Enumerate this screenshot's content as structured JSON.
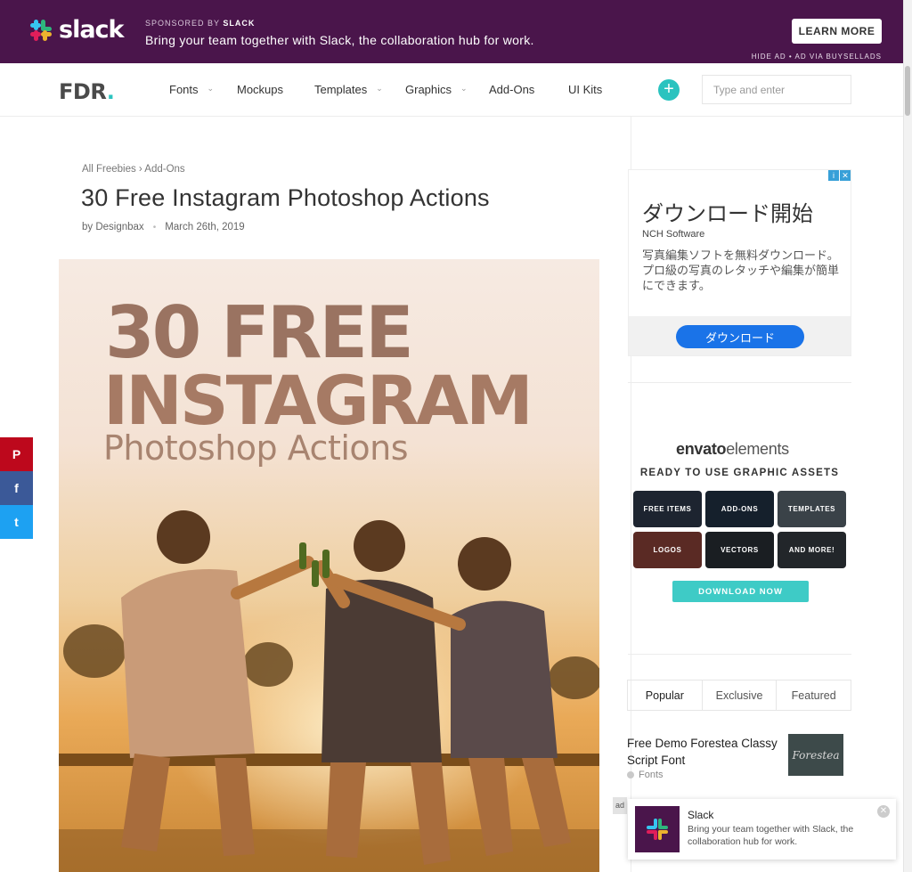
{
  "banner": {
    "sponsored_prefix": "SPONSORED BY",
    "sponsored_brand": "SLACK",
    "logo_text": "slack",
    "text": "Bring your team together with Slack, the collaboration hub for work.",
    "cta": "LEARN MORE",
    "hide_ad": "HIDE AD • AD VIA BUYSELLADS",
    "bg_color": "#4a154b"
  },
  "nav": {
    "logo": "FDR",
    "logo_dot": ".",
    "items": [
      {
        "label": "Fonts",
        "has_dropdown": true
      },
      {
        "label": "Mockups",
        "has_dropdown": false
      },
      {
        "label": "Templates",
        "has_dropdown": true
      },
      {
        "label": "Graphics",
        "has_dropdown": true
      },
      {
        "label": "Add-Ons",
        "has_dropdown": false
      },
      {
        "label": "UI Kits",
        "has_dropdown": false
      }
    ],
    "add_icon": "plus-circle-icon",
    "search_placeholder": "Type and enter",
    "accent_color": "#2bc4c0"
  },
  "article": {
    "breadcrumb": "All Freebies › Add-Ons",
    "title": "30 Free Instagram Photoshop Actions",
    "author": "by Designbax",
    "date": "March 26th, 2019",
    "hero_line1": "30 FREE",
    "hero_line2": "INSTAGRAM",
    "hero_line3": "Photoshop Actions"
  },
  "share": [
    {
      "network": "pinterest",
      "icon": "pinterest-icon",
      "glyph": "P",
      "color": "#bd081c"
    },
    {
      "network": "facebook",
      "icon": "facebook-icon",
      "glyph": "f",
      "color": "#3b5998"
    },
    {
      "network": "twitter",
      "icon": "twitter-icon",
      "glyph": "t",
      "color": "#1da1f2"
    }
  ],
  "sidebar": {
    "ad_jp": {
      "title": "ダウンロード開始",
      "company": "NCH Software",
      "body": "写真編集ソフトを無料ダウンロード。プロ級の写真のレタッチや編集が簡単にできます。",
      "button": "ダウンロード"
    },
    "envato": {
      "logo_bold": "envato",
      "logo_light": "elements",
      "tagline": "READY TO USE GRAPHIC ASSETS",
      "tiles": [
        "FREE ITEMS",
        "ADD-ONS",
        "TEMPLATES",
        "LOGOS",
        "VECTORS",
        "AND MORE!"
      ],
      "button": "DOWNLOAD NOW"
    },
    "tabs": [
      "Popular",
      "Exclusive",
      "Featured"
    ],
    "posts": [
      {
        "title": "Free Demo Forestea Classy Script Font",
        "category": "Fonts",
        "thumb_text": "Forestea"
      }
    ]
  },
  "toast_ad": {
    "label": "ad",
    "title": "Slack",
    "text": "Bring your team together with Slack, the collaboration hub for work."
  }
}
